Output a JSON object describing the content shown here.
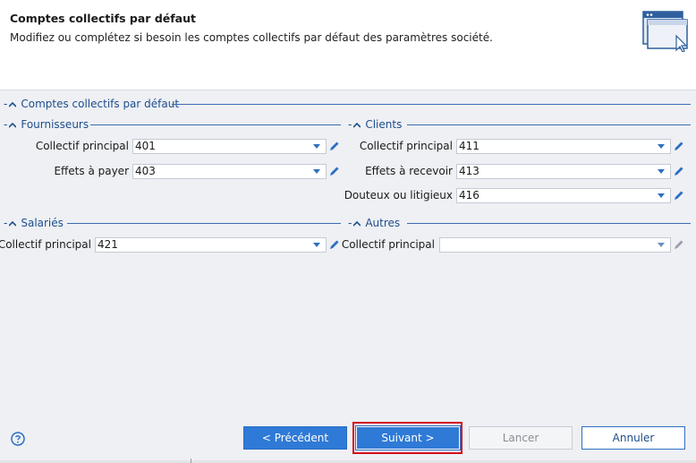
{
  "header": {
    "title": "Comptes collectifs par défaut",
    "subtitle": "Modifiez ou complétez si besoin les comptes collectifs par défaut des paramètres société."
  },
  "main_group": {
    "title": "Comptes collectifs par défaut"
  },
  "fournisseurs": {
    "title": "Fournisseurs",
    "collectif_principal": {
      "label": "Collectif principal",
      "value": "401"
    },
    "effets_a_payer": {
      "label": "Effets à payer",
      "value": "403"
    }
  },
  "clients": {
    "title": "Clients",
    "collectif_principal": {
      "label": "Collectif principal",
      "value": "411"
    },
    "effets_a_recevoir": {
      "label": "Effets à recevoir",
      "value": "413"
    },
    "douteux": {
      "label": "Douteux ou litigieux",
      "value": "416"
    }
  },
  "salaries": {
    "title": "Salariés",
    "collectif_principal": {
      "label": "Collectif principal",
      "value": "421"
    }
  },
  "autres": {
    "title": "Autres",
    "collectif_principal": {
      "label": "Collectif principal",
      "value": ""
    }
  },
  "buttons": {
    "previous": "< Précédent",
    "next": "Suivant >",
    "cancel": "Lancer",
    "abort": "Annuler"
  },
  "colors": {
    "accent": "#2f7ad6",
    "group_title": "#1f4e8c",
    "highlight": "#d5101a"
  },
  "icons": {
    "help": "help-circle-icon",
    "header": "window-cursor-icon",
    "edit": "pencil-icon",
    "dropdown": "chevron-down-icon"
  }
}
